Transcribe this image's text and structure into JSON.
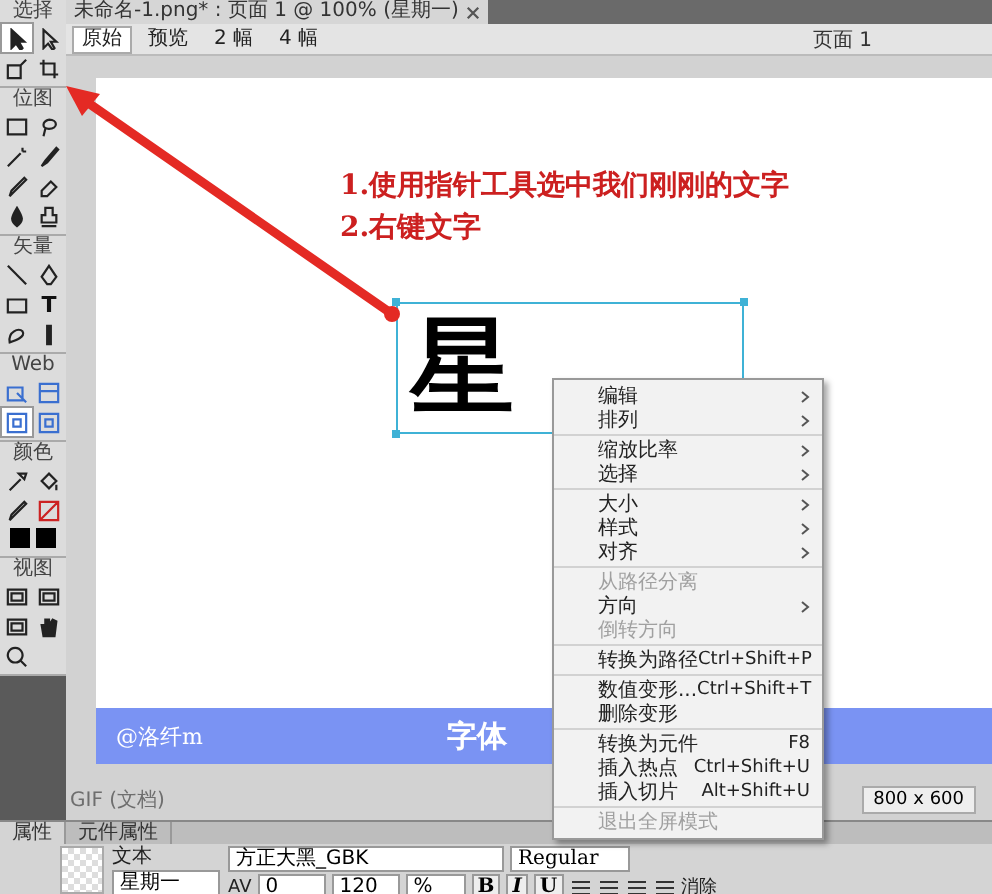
{
  "document_tab": {
    "title": "未命名-1.png* : 页面 1 @ 100% (星期一)"
  },
  "view_buttons": [
    {
      "label": "原始",
      "selected": true
    },
    {
      "label": "预览",
      "selected": false
    },
    {
      "label": "2 幅",
      "selected": false
    },
    {
      "label": "4 幅",
      "selected": false
    }
  ],
  "page_label": "页面 1",
  "toolbox": [
    {
      "label": "选择",
      "tools": [
        {
          "selected": true
        },
        {
          "selected": false
        },
        {
          "selected": false
        },
        {
          "selected": false
        }
      ]
    },
    {
      "label": "位图",
      "tools": [
        {
          "selected": false
        },
        {
          "selected": false
        },
        {
          "selected": false
        },
        {
          "selected": false
        },
        {
          "selected": false
        },
        {
          "selected": false
        },
        {
          "selected": false
        },
        {
          "selected": false
        }
      ]
    },
    {
      "label": "矢量",
      "tools": [
        {
          "selected": false
        },
        {
          "selected": false
        },
        {
          "selected": false
        },
        {
          "selected": false,
          "glyph": "T"
        },
        {
          "selected": false
        },
        {
          "selected": false
        }
      ]
    },
    {
      "label": "Web",
      "tools": [
        {
          "selected": false
        },
        {
          "selected": false
        },
        {
          "selected": true
        },
        {
          "selected": false
        }
      ]
    },
    {
      "label": "颜色",
      "tools": [
        {
          "selected": false
        },
        {
          "selected": false
        },
        {
          "selected": false
        },
        {
          "selected": false
        }
      ]
    },
    {
      "label": "视图",
      "tools": [
        {
          "selected": false
        },
        {
          "selected": false
        },
        {
          "selected": false
        },
        {
          "selected": false
        },
        {
          "selected": false
        }
      ]
    }
  ],
  "annotation": [
    "1.使用指针工具选中我们刚刚的文字",
    "2.右键文字"
  ],
  "canvas_text": "星",
  "banner": {
    "credit": "@洛纤m",
    "title": "字体"
  },
  "status": {
    "format": "GIF (文档)",
    "size": "800 x 600"
  },
  "context_menu": [
    [
      {
        "label": "编辑",
        "submenu": true,
        "disabled": false
      },
      {
        "label": "排列",
        "submenu": true,
        "disabled": false
      }
    ],
    [
      {
        "label": "缩放比率",
        "submenu": true,
        "disabled": false
      },
      {
        "label": "选择",
        "submenu": true,
        "disabled": false
      }
    ],
    [
      {
        "label": "大小",
        "submenu": true,
        "disabled": false
      },
      {
        "label": "样式",
        "submenu": true,
        "disabled": false
      },
      {
        "label": "对齐",
        "submenu": true,
        "disabled": false
      }
    ],
    [
      {
        "label": "从路径分离",
        "submenu": false,
        "disabled": true
      },
      {
        "label": "方向",
        "submenu": true,
        "disabled": false
      },
      {
        "label": "倒转方向",
        "submenu": false,
        "disabled": true
      }
    ],
    [
      {
        "label": "转换为路径",
        "shortcut": "Ctrl+Shift+P",
        "submenu": false,
        "disabled": false
      }
    ],
    [
      {
        "label": "数值变形...",
        "shortcut": "Ctrl+Shift+T",
        "submenu": false,
        "disabled": false
      },
      {
        "label": "删除变形",
        "submenu": false,
        "disabled": false
      }
    ],
    [
      {
        "label": "转换为元件",
        "shortcut": "F8",
        "submenu": false,
        "disabled": false
      },
      {
        "label": "插入热点",
        "shortcut": "Ctrl+Shift+U",
        "submenu": false,
        "disabled": false
      },
      {
        "label": "插入切片",
        "shortcut": "Alt+Shift+U",
        "submenu": false,
        "disabled": false
      }
    ],
    [
      {
        "label": "退出全屏模式",
        "submenu": false,
        "disabled": true
      }
    ]
  ],
  "properties": {
    "tabs": [
      {
        "label": "属性",
        "selected": true
      },
      {
        "label": "元件属性",
        "selected": false
      }
    ],
    "object_type": "文本",
    "name": "星期一",
    "font": "方正大黑_GBK",
    "style": "Regular",
    "kerning_label": "AV",
    "kerning": "0",
    "leading": "120",
    "leading_unit": "%",
    "format_buttons": [
      "B",
      "I",
      "U"
    ],
    "antialias_label": "消除"
  }
}
